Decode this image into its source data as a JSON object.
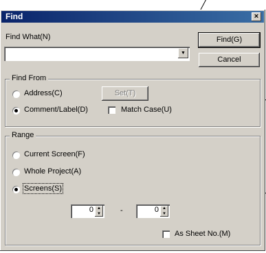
{
  "window": {
    "title": "Find",
    "close_label": "×"
  },
  "find_what": {
    "label": "Find What(N)",
    "value": "",
    "arrow": "▼"
  },
  "buttons": {
    "find": "Find(G)",
    "cancel": "Cancel",
    "set": "Set(T)"
  },
  "find_from": {
    "title": "Find From",
    "address_label": "Address(C)",
    "address_checked": false,
    "comment_label": "Comment/Label(D)",
    "comment_checked": true,
    "match_case_label": "Match Case(U)",
    "match_case_checked": false
  },
  "range": {
    "title": "Range",
    "current_screen_label": "Current Screen(F)",
    "whole_project_label": "Whole Project(A)",
    "screens_label": "Screens(S)",
    "selected": "screens",
    "from_value": "0",
    "separator": "-",
    "to_value": "0",
    "as_sheet_label": "As Sheet No.(M)",
    "as_sheet_checked": false
  },
  "icons": {
    "combo_arrow": "dropdown-arrow-icon",
    "spin": "spin-arrows-icon"
  }
}
